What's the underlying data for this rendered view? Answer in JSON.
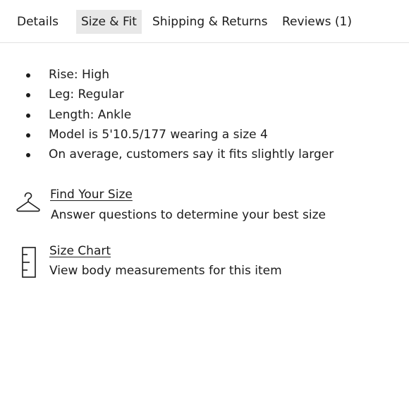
{
  "tabs": [
    {
      "label": "Details",
      "active": false
    },
    {
      "label": "Size & Fit",
      "active": true
    },
    {
      "label": "Shipping & Returns",
      "active": false
    },
    {
      "label": "Reviews (1)",
      "active": false
    }
  ],
  "fit_details": [
    "Rise: High",
    "Leg: Regular",
    "Length: Ankle",
    "Model is 5'10.5/177 wearing a size 4",
    "On average, customers say it fits slightly larger"
  ],
  "find_your_size": {
    "icon": "hanger-icon",
    "link": "Find Your Size",
    "description": "Answer questions to determine your best size"
  },
  "size_chart": {
    "icon": "ruler-icon",
    "link": "Size Chart",
    "description": "View body measurements for this item"
  },
  "colors": {
    "text": "#1c1c1c",
    "active_tab_bg": "#e8e8e8",
    "divider": "#e3e3e3"
  }
}
